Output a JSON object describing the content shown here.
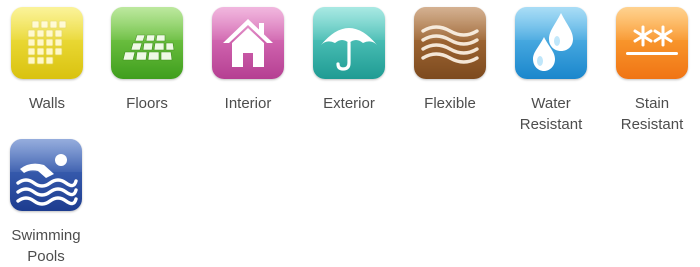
{
  "features": [
    {
      "id": "walls",
      "lines": [
        "Walls"
      ],
      "icon": "wall-tiles-icon",
      "color": "#e6d21f"
    },
    {
      "id": "floors",
      "lines": [
        "Floors"
      ],
      "icon": "floor-tiles-icon",
      "color": "#5cb82f"
    },
    {
      "id": "interior",
      "lines": [
        "Interior"
      ],
      "icon": "house-icon",
      "color": "#cf5aaa"
    },
    {
      "id": "exterior",
      "lines": [
        "Exterior"
      ],
      "icon": "umbrella-icon",
      "color": "#35b5ab"
    },
    {
      "id": "flexible",
      "lines": [
        "Flexible"
      ],
      "icon": "waves-icon",
      "color": "#9a5f2c"
    },
    {
      "id": "water-resistant",
      "lines": [
        "Water",
        "Resistant"
      ],
      "icon": "water-drops-icon",
      "color": "#2ea2e0"
    },
    {
      "id": "stain-resistant",
      "lines": [
        "Stain",
        "Resistant"
      ],
      "icon": "asterisks-icon",
      "color": "#f58b20"
    },
    {
      "id": "swimming-pools",
      "lines": [
        "Swimming",
        "Pools"
      ],
      "icon": "swimmer-icon",
      "color": "#2b4fa6"
    }
  ]
}
